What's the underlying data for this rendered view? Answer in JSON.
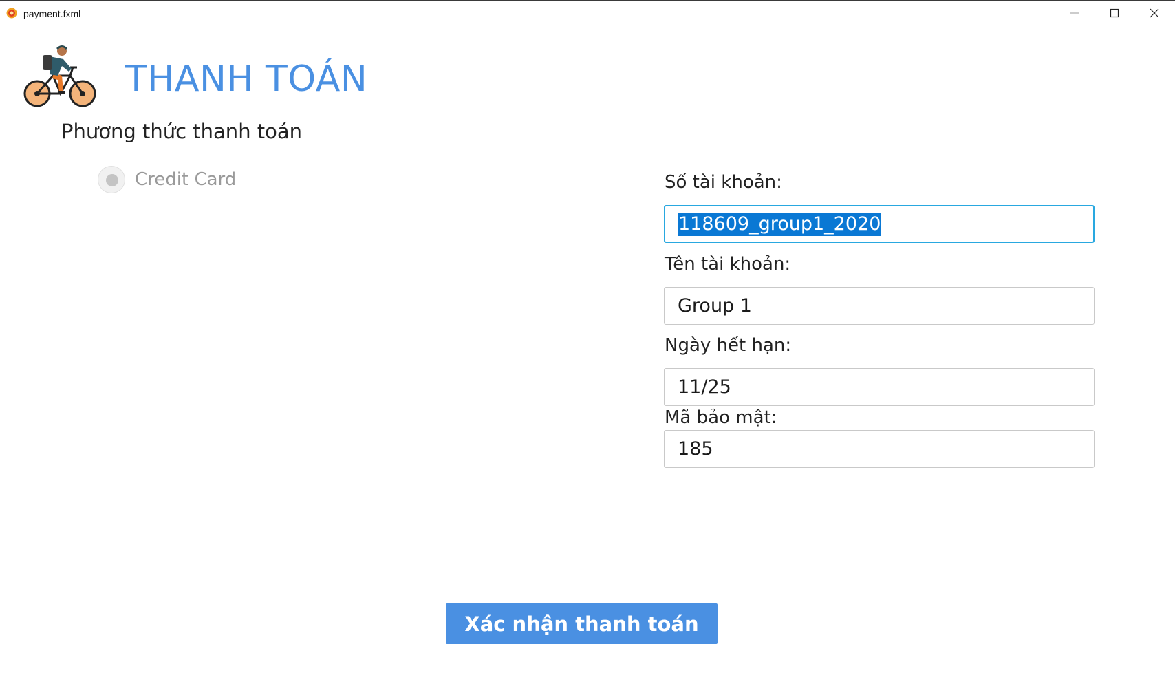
{
  "window": {
    "title": "payment.fxml",
    "icon": "app-icon"
  },
  "header": {
    "title": "THANH TOÁN",
    "logo": "bicycle-rider-icon"
  },
  "payment_method": {
    "label": "Phương thức thanh toán",
    "options": [
      {
        "label": "Credit Card",
        "selected": true,
        "disabled": true
      }
    ]
  },
  "form": {
    "account_number": {
      "label": "Số tài khoản:",
      "value": "118609_group1_2020"
    },
    "account_name": {
      "label": "Tên tài khoản:",
      "value": "Group 1"
    },
    "expiry_date": {
      "label": "Ngày hết hạn:",
      "value": "11/25"
    },
    "security_code": {
      "label": "Mã bảo mật:",
      "value": "185"
    }
  },
  "actions": {
    "confirm_label": "Xác nhận thanh toán"
  },
  "colors": {
    "accent": "#4a90e2",
    "focus_border": "#29a8e0",
    "selection": "#0a78d4"
  }
}
